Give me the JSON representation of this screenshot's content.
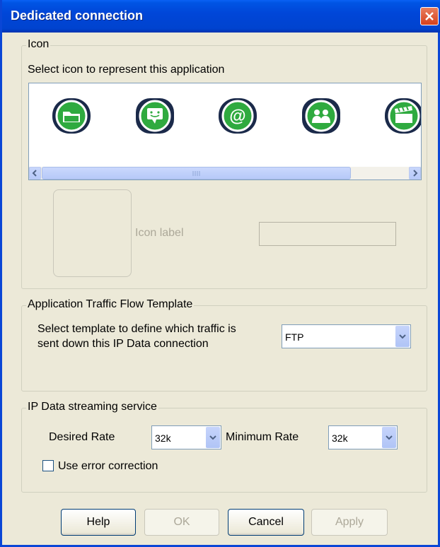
{
  "window": {
    "title": "Dedicated connection"
  },
  "icon_group": {
    "legend": "Icon",
    "instruction": "Select icon to represent this application",
    "icons": [
      {
        "name": "folder-icon"
      },
      {
        "name": "chat-icon"
      },
      {
        "name": "email-at-icon"
      },
      {
        "name": "people-icon"
      },
      {
        "name": "clapperboard-icon"
      }
    ],
    "icon_label_caption": "Icon label",
    "icon_label_value": ""
  },
  "traffic_group": {
    "legend": "Application Traffic Flow Template",
    "description_line1": "Select template to define which traffic is",
    "description_line2": "sent down this IP Data connection",
    "template_value": "FTP"
  },
  "streaming_group": {
    "legend": "IP Data streaming service",
    "desired_rate_label": "Desired Rate",
    "desired_rate_value": "32k",
    "minimum_rate_label": "Minimum Rate",
    "minimum_rate_value": "32k",
    "error_correction_label": "Use error correction",
    "error_correction_checked": false
  },
  "buttons": {
    "help": "Help",
    "ok": "OK",
    "cancel": "Cancel",
    "apply": "Apply"
  },
  "colors": {
    "titlebar": "#0046d8",
    "icon_green": "#2faa3f",
    "icon_navy": "#1b2a4a"
  }
}
